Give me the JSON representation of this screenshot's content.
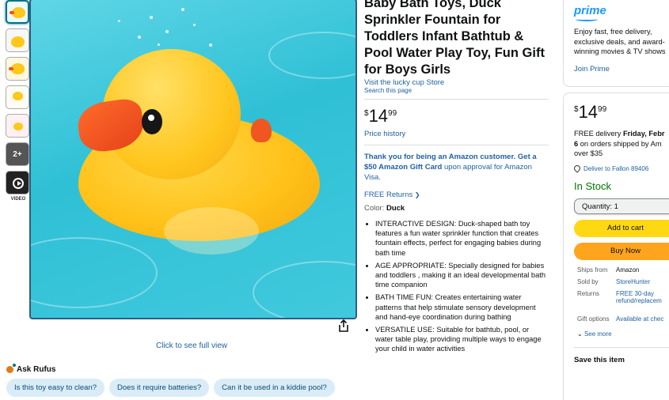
{
  "thumbnails": {
    "more_count": "2+",
    "video_label": "VIDEO"
  },
  "gallery": {
    "full_view": "Click to see full view"
  },
  "rufus": {
    "label": "Ask Rufus",
    "questions": [
      "Is this toy easy to clean?",
      "Does it require batteries?",
      "Can it be used in a kiddie pool?"
    ]
  },
  "product": {
    "title": "Baby Bath Toys, Duck Sprinkler Fountain for Toddlers Infant Bathtub & Pool Water Play Toy, Fun Gift for Boys Girls",
    "store_link": "Visit the lucky cup Store",
    "search_link": "Search this page",
    "price_symbol": "$",
    "price_whole": "14",
    "price_fraction": "99",
    "price_history": "Price history",
    "promo_bold": "Thank you for being an Amazon customer. Get a $50 Amazon Gift Card",
    "promo_rest": " upon approval for Amazon Visa.",
    "returns": "FREE Returns",
    "color_label": "Color: ",
    "color_value": "Duck",
    "bullets": [
      "INTERACTIVE DESIGN: Duck-shaped bath toy features a fun water sprinkler function that creates fountain effects, perfect for engaging babies during bath time",
      "AGE APPROPRIATE: Specially designed for babies and toddlers , making it an ideal developmental bath time companion",
      "BATH TIME FUN: Creates entertaining water patterns that help stimulate sensory development and hand-eye coordination during bathing",
      "VERSATILE USE: Suitable for bathtub, pool, or water table play, providing multiple ways to engage your child in water activities"
    ]
  },
  "prime": {
    "logo": "prime",
    "line1": "Enjoy fast, free delivery,",
    "line2": "exclusive deals, and award-",
    "line3": "winning movies & TV shows",
    "join": "Join Prime"
  },
  "buybox": {
    "price_symbol": "$",
    "price_whole": "14",
    "price_fraction": "99",
    "delivery_line1_pre": "FREE delivery ",
    "delivery_line1_bold": "Friday, Febr",
    "delivery_line2_bold": "6",
    "delivery_line2_rest": " on orders shipped by Am",
    "delivery_line3": "over $35",
    "deliver_to": "Deliver to Fallon 89406",
    "stock": "In Stock",
    "quantity": "Quantity: 1",
    "add_to_cart": "Add to cart",
    "buy_now": "Buy Now",
    "ships_from_label": "Ships from",
    "ships_from": "Amazon",
    "sold_by_label": "Sold by",
    "sold_by": "StoreHunter",
    "returns_label": "Returns",
    "returns_line1": "FREE 30-day",
    "returns_line2": "refund/replacem",
    "gift_label": "Gift options",
    "gift_value": "Available at chec",
    "see_more": "See more",
    "save_item": "Save this item"
  }
}
